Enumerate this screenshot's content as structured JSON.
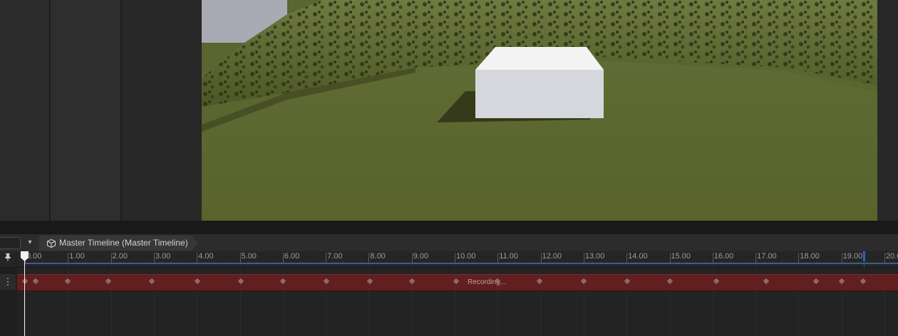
{
  "timeline": {
    "breadcrumb_label": "Master Timeline (Master Timeline)",
    "dropdown_glyph": "▾",
    "pin_glyph": "📌",
    "track_menu_glyph": "⋮",
    "ruler_labels": [
      "0.00",
      "1.00",
      "2.00",
      "3.00",
      "4.00",
      "5.00",
      "6.00",
      "7.00",
      "8.00",
      "9.00",
      "10.00",
      "11.00",
      "12.00",
      "13.00",
      "14.00",
      "15.00",
      "16.00",
      "17.00",
      "18.00",
      "19.00",
      "20.0"
    ],
    "clip_label": "Recording...",
    "playhead_time": 0,
    "end_time": 19.3,
    "icons": {
      "breadcrumb": "cube-icon",
      "dropdown": "chevron-down-icon",
      "pin": "pin-icon",
      "track_menu": "more-vertical-icon"
    },
    "colors": {
      "clip": "#621f1f",
      "end_marker": "#2e6fd6",
      "playhead": "#f0f0f0"
    }
  }
}
